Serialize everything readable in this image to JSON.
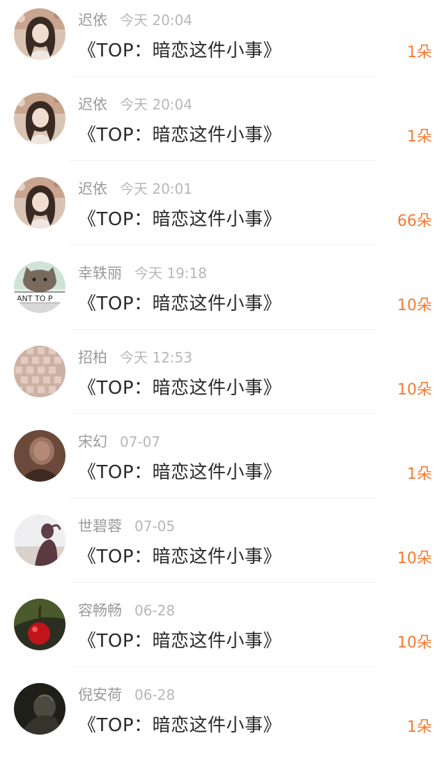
{
  "items": [
    {
      "name": "迟依",
      "time": "今天 20:04",
      "title": "《TOP：暗恋这件小事》",
      "gift": "1朵",
      "avatar": "girl-photo-avatar"
    },
    {
      "name": "迟依",
      "time": "今天 20:04",
      "title": "《TOP：暗恋这件小事》",
      "gift": "1朵",
      "avatar": "girl-photo-avatar"
    },
    {
      "name": "迟依",
      "time": "今天 20:01",
      "title": "《TOP：暗恋这件小事》",
      "gift": "66朵",
      "avatar": "girl-photo-avatar"
    },
    {
      "name": "幸轶丽",
      "time": "今天 19:18",
      "title": "《TOP：暗恋这件小事》",
      "gift": "10朵",
      "avatar": "cat-cartoon-avatar"
    },
    {
      "name": "招柏",
      "time": "今天 12:53",
      "title": "《TOP：暗恋这件小事》",
      "gift": "10朵",
      "avatar": "pattern-avatar"
    },
    {
      "name": "宋幻",
      "time": "07-07",
      "title": "《TOP：暗恋这件小事》",
      "gift": "1朵",
      "avatar": "dark-portrait-avatar"
    },
    {
      "name": "世碧蓉",
      "time": "07-05",
      "title": "《TOP：暗恋这件小事》",
      "gift": "10朵",
      "avatar": "silhouette-avatar"
    },
    {
      "name": "容畅畅",
      "time": "06-28",
      "title": "《TOP：暗恋这件小事》",
      "gift": "10朵",
      "avatar": "cherry-avatar"
    },
    {
      "name": "倪安荷",
      "time": "06-28",
      "title": "《TOP：暗恋这件小事》",
      "gift": "1朵",
      "avatar": "dark-photo-avatar"
    }
  ],
  "colors": {
    "name": "#9a9a9a",
    "time": "#b7b7b7",
    "title": "#2a2a2a",
    "gift": "#f47a32",
    "divider": "#f1f1f1"
  }
}
